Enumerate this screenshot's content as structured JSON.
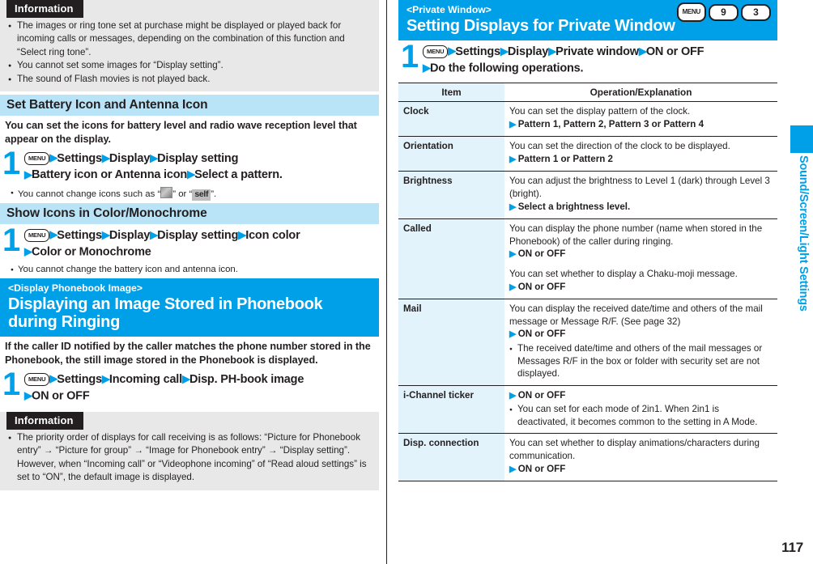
{
  "page": {
    "number": "117",
    "thumb_tab_label": "Sound/Screen/Light Settings",
    "accent_color": "#00a0e9",
    "section_bar_color": "#b9e4f7",
    "info_box_color": "#e8e8e8"
  },
  "left": {
    "info_top": {
      "label": "Information",
      "items": [
        "The images or ring tone set at purchase might be displayed or played back for incoming calls or messages, depending on the combination of this function and “Select ring tone”.",
        "You cannot set some images for “Display setting”.",
        "The sound of Flash movies is not played back."
      ]
    },
    "section_battery": {
      "heading": "Set Battery Icon and Antenna Icon",
      "intro": "You can set the icons for battery level and radio wave reception level that appear on the display.",
      "step_number": "1",
      "menu_key": "MENU",
      "step_line1": "Settings▶Display▶Display setting",
      "step_line2": "Battery icon or Antenna icon▶Select a pattern.",
      "note_prefix": "You cannot change icons such as “",
      "note_middle": "” or “",
      "note_icon_self": "self",
      "note_suffix": "”."
    },
    "section_icon_color": {
      "heading": "Show Icons in Color/Monochrome",
      "step_number": "1",
      "menu_key": "MENU",
      "step_line1": "Settings▶Display▶Display setting▶Icon color",
      "step_line2": "Color or Monochrome",
      "note": "You cannot change the battery icon and antenna icon."
    },
    "chapter": {
      "sub": "<Display Phonebook Image>",
      "title": "Displaying an Image Stored in Phonebook during Ringing"
    },
    "section_phonebook": {
      "intro": "If the caller ID notified by the caller matches the phone number stored in the Phonebook, the still image stored in the Phonebook is displayed.",
      "step_number": "1",
      "menu_key": "MENU",
      "step_line1": "Settings▶Incoming call▶Disp. PH-book image",
      "step_line2": "ON or OFF"
    },
    "info_bottom": {
      "label": "Information",
      "items": [
        "The priority order of displays for call receiving is as follows: “Picture for Phonebook entry” → “Picture for group” → “Image for Phonebook entry” → “Display setting”. However, when “Incoming call” or “Videophone incoming” of “Read aloud settings” is set to “ON”, the default image is displayed."
      ]
    }
  },
  "right": {
    "chapter": {
      "sub": "<Private Window>",
      "title": "Setting Displays for Private Window",
      "keys": [
        "MENU",
        "9",
        "3"
      ]
    },
    "step": {
      "number": "1",
      "menu_key": "MENU",
      "line1": "Settings▶Display▶Private window▶ON or OFF",
      "line2": "Do the following operations."
    },
    "table": {
      "headers": [
        "Item",
        "Operation/Explanation"
      ],
      "rows": [
        {
          "item": "Clock",
          "blocks": [
            {
              "kind": "text",
              "text": "You can set the display pattern of the clock."
            },
            {
              "kind": "option",
              "text": "Pattern 1, Pattern 2, Pattern 3 or Pattern 4"
            }
          ]
        },
        {
          "item": "Orientation",
          "blocks": [
            {
              "kind": "text",
              "text": "You can set the direction of the clock to be displayed."
            },
            {
              "kind": "option",
              "text": "Pattern 1 or Pattern 2"
            }
          ]
        },
        {
          "item": "Brightness",
          "blocks": [
            {
              "kind": "text",
              "text": "You can adjust the brightness to Level 1 (dark) through Level 3 (bright)."
            },
            {
              "kind": "option",
              "text": "Select a brightness level."
            }
          ]
        },
        {
          "item": "Called",
          "blocks": [
            {
              "kind": "text",
              "text": "You can display the phone number (name when stored in the Phonebook) of the caller during ringing."
            },
            {
              "kind": "option",
              "text": "ON or OFF"
            },
            {
              "kind": "gap",
              "text": ""
            },
            {
              "kind": "text",
              "text": "You can set whether to display a Chaku-moji message."
            },
            {
              "kind": "option",
              "text": "ON or OFF"
            }
          ]
        },
        {
          "item": "Mail",
          "blocks": [
            {
              "kind": "text",
              "text": "You can display the received date/time and others of the mail message or Message R/F. (See page 32)"
            },
            {
              "kind": "option",
              "text": "ON or OFF"
            },
            {
              "kind": "subnote",
              "text": "The received date/time and others of the mail messages or Messages R/F in the box or folder with security set are not displayed."
            }
          ]
        },
        {
          "item": "i-Channel ticker",
          "blocks": [
            {
              "kind": "option",
              "text": "ON or OFF"
            },
            {
              "kind": "subnote",
              "text": "You can set for each mode of 2in1. When 2in1 is deactivated, it becomes common to the setting in A Mode."
            }
          ]
        },
        {
          "item": "Disp. connection",
          "blocks": [
            {
              "kind": "text",
              "text": "You can set whether to display animations/characters during communication."
            },
            {
              "kind": "option",
              "text": "ON or OFF"
            }
          ]
        }
      ]
    }
  }
}
